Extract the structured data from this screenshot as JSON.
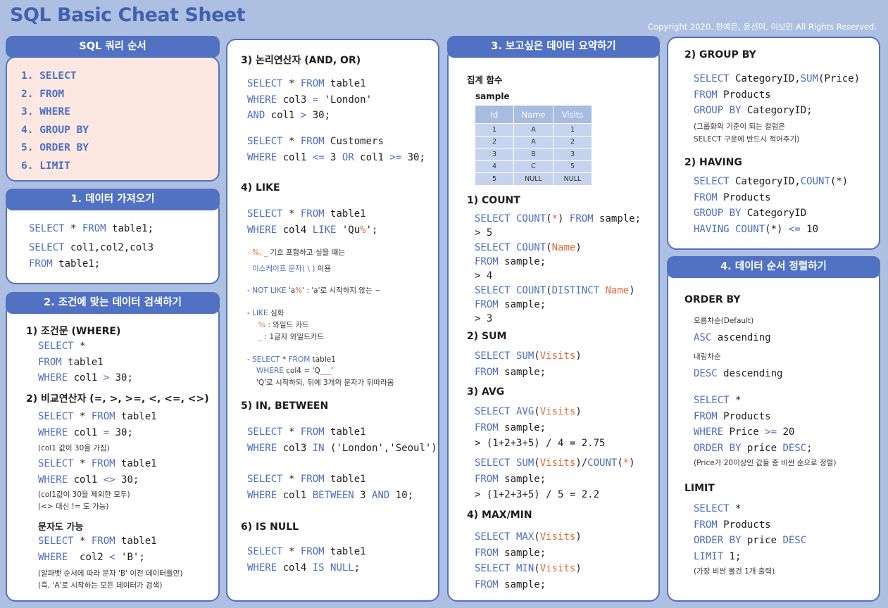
{
  "title": "SQL Basic Cheat Sheet",
  "copyright": "Copyright 2020. 한예은, 윤선미, 이보민 All Rights Reserved.",
  "colors": {
    "accent": "#5172c2",
    "keyword": "#4a6ec2",
    "highlight": "#e56a3a",
    "background": "#aec0e2",
    "order_bg": "#fde7e1"
  },
  "order": {
    "header": "SQL 쿼리 순서",
    "items": [
      "1. SELECT",
      "2. FROM",
      "3. WHERE",
      "4. GROUP BY",
      "5. ORDER BY",
      "6. LIMIT"
    ]
  },
  "s1": {
    "header": "1. 데이터 가져오기",
    "lines": [
      "SELECT * FROM table1;",
      "SELECT col1,col2,col3",
      "FROM table1;"
    ]
  },
  "s2": {
    "header": "2. 조건에 맞는 데이터 검색하기",
    "where_title": "1) 조건문 (WHERE)",
    "where_code": [
      "SELECT *",
      "FROM table1",
      "WHERE col1 > 30;"
    ],
    "cmp_title": "2) 비교연산자 (=, >, >=, <, <=, <>)",
    "cmp_code1": [
      "SELECT * FROM table1",
      "WHERE col1 = 30;"
    ],
    "cmp_note1": "(col1 값이 30을 가짐)",
    "cmp_code2": [
      "SELECT * FROM table1",
      "WHERE col1 <> 30;"
    ],
    "cmp_note2a": "(col1값이 30을 제외한 모두)",
    "cmp_note2b": "(<> 대신 != 도 가능)",
    "str_title": "문자도 가능",
    "str_code": [
      "SELECT * FROM table1",
      "WHERE  col2 < 'B';"
    ],
    "str_note_a": "(알파벳 순서에 따라 문자 'B' 이전 데이터들만)",
    "str_note_b": "(즉, 'A'로 시작하는 모든 데이터가 검색)"
  },
  "col2": {
    "logic_title": "3) 논리연산자 (AND, OR)",
    "logic_code1": [
      "SELECT * FROM table1",
      "WHERE col3 = 'London'",
      "AND col1 > 30;"
    ],
    "logic_code2": [
      "SELECT * FROM Customers",
      "WHERE col1 <= 3 OR col1 >= 30;"
    ],
    "like_title": "4) LIKE",
    "like_code": [
      "SELECT * FROM table1",
      "WHERE col4 LIKE 'Qu%';"
    ],
    "like_note1a": "- %, _ 기호 포함하고 싶을 때는",
    "like_note1b": "이스케이프 문자( \\ ) 이용",
    "like_note2": "- NOT LIKE 'a%' : 'a'로 시작하지 않는 ~",
    "like_note3a": "- LIKE 심화",
    "like_note3b": "% : 와일드 카드",
    "like_note3c": "_ : 1글자 와일드카드",
    "like_note4a": "- SELECT * FROM table1",
    "like_note4b": "WHERE col4 = 'Q___'",
    "like_note4c": "'Q'로 시작하되, 뒤에 3개의 문자가 뒤따라옴",
    "in_title": "5) IN, BETWEEN",
    "in_code1": [
      "SELECT * FROM table1",
      "WHERE col3 IN ('London','Seoul');"
    ],
    "in_code2": [
      "SELECT * FROM table1",
      "WHERE col1 BETWEEN 3 AND 10;"
    ],
    "null_title": "6) IS NULL",
    "null_code": [
      "SELECT * FROM table1",
      "WHERE col4 IS NULL;"
    ]
  },
  "s3": {
    "header": "3. 보고싶은 데이터 요약하기",
    "agg_title": "집계 함수",
    "sample_title": "sample",
    "table_headers": [
      "Id",
      "Name",
      "Visits"
    ],
    "table_rows": [
      [
        "1",
        "A",
        "1"
      ],
      [
        "2",
        "A",
        "2"
      ],
      [
        "3",
        "B",
        "3"
      ],
      [
        "4",
        "C",
        "5"
      ],
      [
        "5",
        "NULL",
        "NULL"
      ]
    ],
    "count_title": "1) COUNT",
    "count_code": [
      "SELECT COUNT(*) FROM sample;",
      "> 5",
      "SELECT COUNT(Name)",
      "FROM sample;",
      "> 4",
      "SELECT COUNT(DISTINCT Name)",
      "FROM sample;",
      "> 3"
    ],
    "sum_title": "2) SUM",
    "sum_code": [
      "SELECT SUM(Visits)",
      "FROM sample;"
    ],
    "avg_title": "3) AVG",
    "avg_code": [
      "SELECT AVG(Visits)",
      "FROM sample;",
      "> (1+2+3+5) / 4 = 2.75",
      "SELECT SUM(Visits)/COUNT(*)",
      "FROM sample;",
      "> (1+2+3+5) / 5 = 2.2"
    ],
    "max_title": "4) MAX/MIN",
    "max_code": [
      "SELECT MAX(Visits)",
      "FROM sample;",
      "SELECT MIN(Visits)",
      "FROM sample;"
    ]
  },
  "col4": {
    "group_title": "2) GROUP BY",
    "group_code": [
      "SELECT CategoryID,SUM(Price)",
      "FROM Products",
      "GROUP BY CategoryID;"
    ],
    "group_note_a": "(그룹화의 기준이 되는 컬럼은",
    "group_note_b": "SELECT 구문에 반드시 적어주기)",
    "having_title": "2) HAVING",
    "having_code": [
      "SELECT CategoryID,COUNT(*)",
      "FROM Products",
      "GROUP BY CategoryID",
      "HAVING COUNT(*) <= 10"
    ]
  },
  "s4": {
    "header": "4. 데이터 순서 정렬하기",
    "orderby_title": "ORDER BY",
    "asc_label": "오름차순(Default)",
    "asc_code": "ASC ascending",
    "desc_label": "내림차순",
    "desc_code": "DESC descending",
    "ob_code": [
      "SELECT *",
      "FROM Products",
      "WHERE Price >= 20",
      "ORDER BY price DESC;"
    ],
    "ob_note": "(Price가 20이상인 값들 중 비싼 순으로 정렬)",
    "limit_title": "LIMIT",
    "limit_code": [
      "SELECT *",
      "FROM Products",
      "ORDER BY price DESC",
      "LIMIT 1;"
    ],
    "limit_note": "(가장 비싼 물건 1개 출력)"
  }
}
